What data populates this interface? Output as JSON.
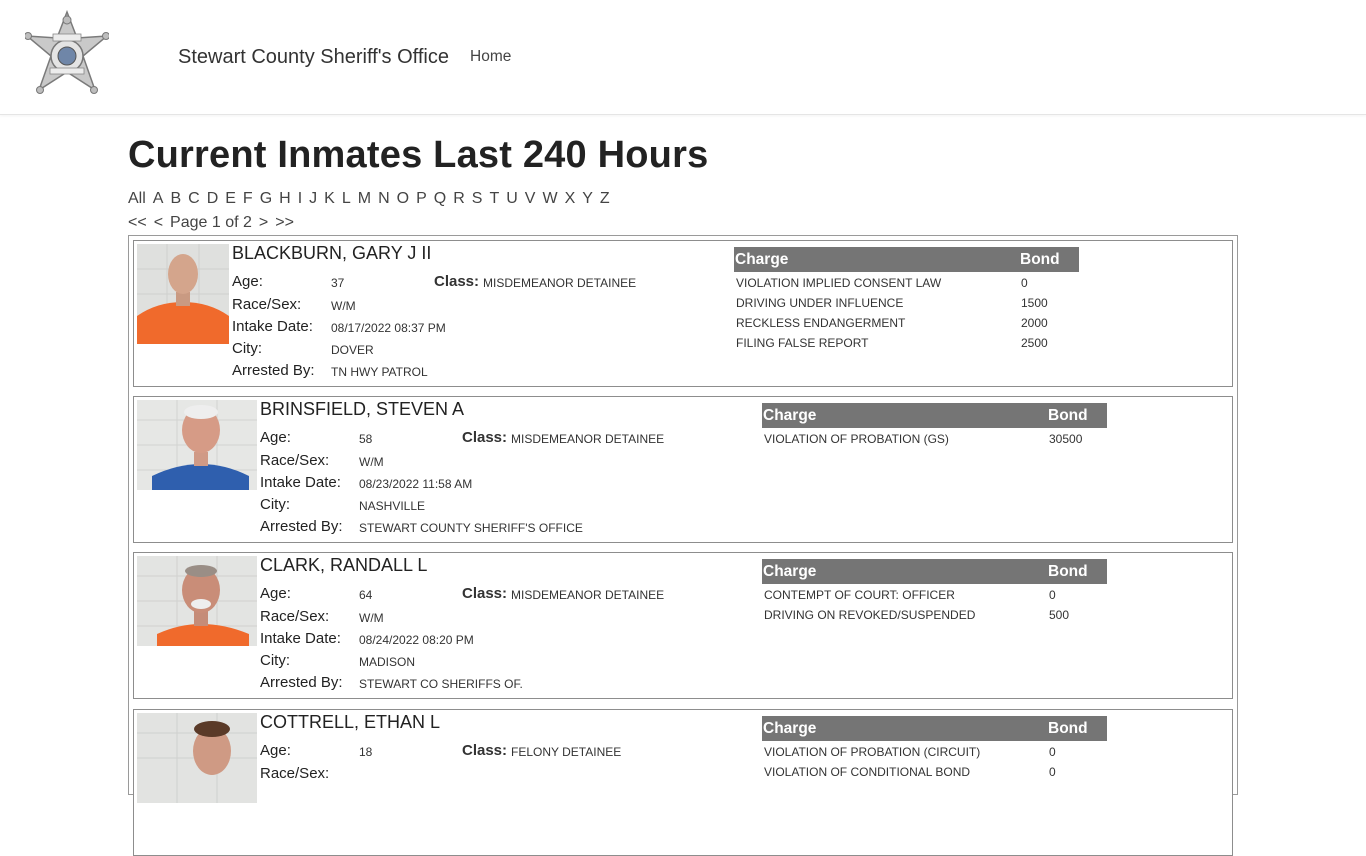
{
  "header": {
    "brand": "Stewart County Sheriff's Office",
    "nav": [
      {
        "label": "Home"
      }
    ],
    "logo_text": "DEPUTY SHERIFF STEWART COUNTY TN"
  },
  "page": {
    "title": "Current Inmates Last 240 Hours",
    "letters": [
      "All",
      "A",
      "B",
      "C",
      "D",
      "E",
      "F",
      "G",
      "H",
      "I",
      "J",
      "K",
      "L",
      "M",
      "N",
      "O",
      "P",
      "Q",
      "R",
      "S",
      "T",
      "U",
      "V",
      "W",
      "X",
      "Y",
      "Z"
    ],
    "pager": {
      "first": "<<",
      "prev": "<",
      "status": "Page 1 of 2",
      "next": ">",
      "last": ">>"
    }
  },
  "labels": {
    "age": "Age:",
    "race_sex": "Race/Sex:",
    "intake_date": "Intake Date:",
    "city": "City:",
    "arrested_by": "Arrested By:",
    "class": "Class:",
    "charge": "Charge",
    "bond": "Bond"
  },
  "inmates": [
    {
      "name": "BLACKBURN, GARY J II",
      "age": "37",
      "race_sex": "W/M",
      "intake_date": "08/17/2022 08:37 PM",
      "city": "DOVER",
      "arrested_by": "TN HWY PATROL",
      "class": "MISDEMEANOR DETAINEE",
      "charges": [
        {
          "charge": "VIOLATION IMPLIED CONSENT LAW",
          "bond": "0"
        },
        {
          "charge": "DRIVING UNDER INFLUENCE",
          "bond": "1500"
        },
        {
          "charge": "RECKLESS ENDANGERMENT",
          "bond": "2000"
        },
        {
          "charge": "FILING FALSE REPORT",
          "bond": "2500"
        }
      ]
    },
    {
      "name": "BRINSFIELD, STEVEN A",
      "age": "58",
      "race_sex": "W/M",
      "intake_date": "08/23/2022 11:58 AM",
      "city": "NASHVILLE",
      "arrested_by": "STEWART COUNTY SHERIFF'S OFFICE",
      "class": "MISDEMEANOR DETAINEE",
      "charges": [
        {
          "charge": "VIOLATION OF PROBATION (GS)",
          "bond": "30500"
        }
      ]
    },
    {
      "name": "CLARK, RANDALL L",
      "age": "64",
      "race_sex": "W/M",
      "intake_date": "08/24/2022 08:20 PM",
      "city": "MADISON",
      "arrested_by": "STEWART CO SHERIFFS OF.",
      "class": "MISDEMEANOR DETAINEE",
      "charges": [
        {
          "charge": "CONTEMPT OF COURT: OFFICER",
          "bond": "0"
        },
        {
          "charge": "DRIVING ON REVOKED/SUSPENDED",
          "bond": "500"
        }
      ]
    },
    {
      "name": "COTTRELL, ETHAN L",
      "age": "18",
      "race_sex": "",
      "intake_date": "",
      "city": "",
      "arrested_by": "",
      "class": "FELONY DETAINEE",
      "charges": [
        {
          "charge": "VIOLATION OF PROBATION (CIRCUIT)",
          "bond": "0"
        },
        {
          "charge": "VIOLATION OF CONDITIONAL BOND",
          "bond": "0"
        }
      ]
    }
  ],
  "colors": {
    "table_header": "#757575",
    "orange_jumpsuit": "#f06a2c",
    "blue_shirt": "#2f5fae"
  }
}
